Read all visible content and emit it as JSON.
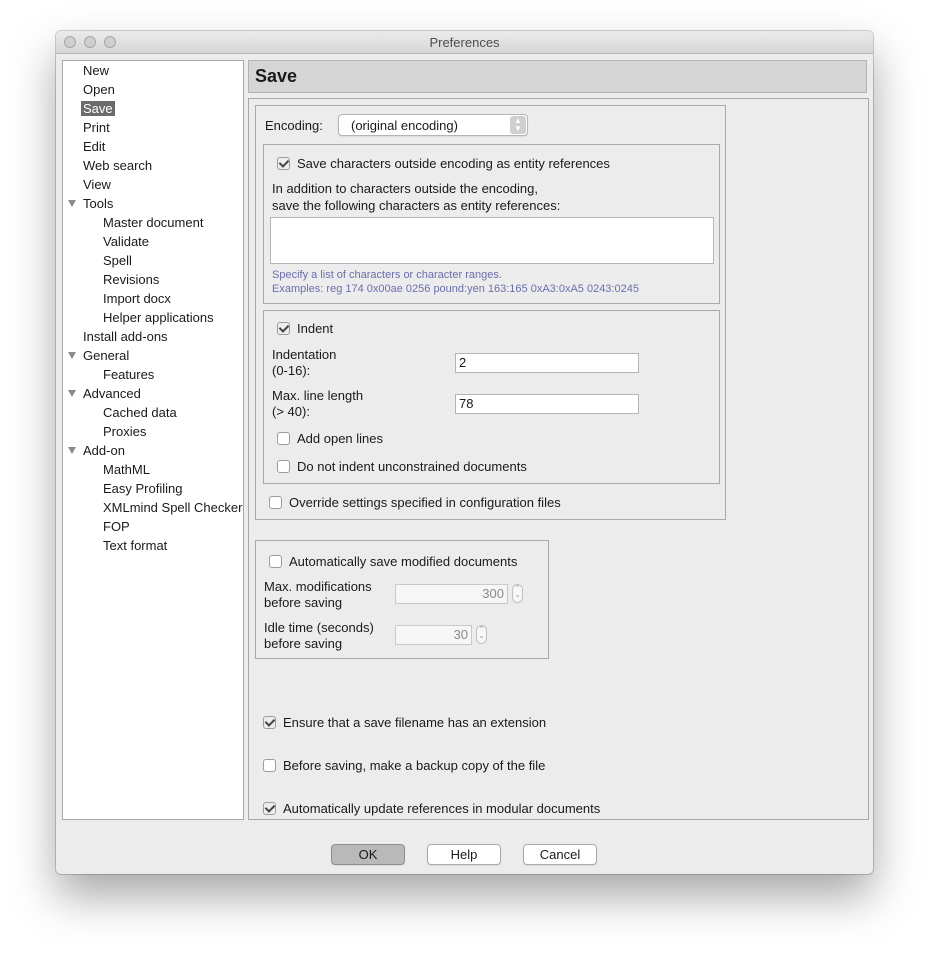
{
  "window": {
    "title": "Preferences"
  },
  "nav": {
    "items": [
      {
        "label": "New"
      },
      {
        "label": "Open"
      },
      {
        "label": "Save"
      },
      {
        "label": "Print"
      },
      {
        "label": "Edit"
      },
      {
        "label": "Web search"
      },
      {
        "label": "View"
      },
      {
        "label": "Tools"
      },
      {
        "label": "Master document"
      },
      {
        "label": "Validate"
      },
      {
        "label": "Spell"
      },
      {
        "label": "Revisions"
      },
      {
        "label": "Import docx"
      },
      {
        "label": "Helper applications"
      },
      {
        "label": "Install add-ons"
      },
      {
        "label": "General"
      },
      {
        "label": "Features"
      },
      {
        "label": "Advanced"
      },
      {
        "label": "Cached data"
      },
      {
        "label": "Proxies"
      },
      {
        "label": "Add-on"
      },
      {
        "label": "MathML"
      },
      {
        "label": "Easy Profiling"
      },
      {
        "label": "XMLmind Spell Checker"
      },
      {
        "label": "FOP"
      },
      {
        "label": "Text format"
      }
    ]
  },
  "page": {
    "title": "Save",
    "encoding": {
      "label": "Encoding:",
      "selected": "(original encoding)"
    },
    "entity": {
      "save_outside_label": "Save characters outside encoding as entity references",
      "save_outside_checked": true,
      "desc_line1": "In addition to characters outside the encoding,",
      "desc_line2": "save the following characters as entity references:",
      "chars_value": "",
      "hint_line1": "Specify a list of characters or character ranges.",
      "hint_line2": "Examples: reg 174 0x00ae 0256 pound:yen 163:165 0xA3:0xA5 0243:0245"
    },
    "indent": {
      "label": "Indent",
      "checked": true,
      "indentation_label1": "Indentation",
      "indentation_label2": "(0-16):",
      "indentation_value": "2",
      "max_line_label1": "Max. line length",
      "max_line_label2": "(> 40):",
      "max_line_value": "78",
      "open_lines_label": "Add open lines",
      "open_lines_checked": false,
      "unconstrained_label": "Do not indent unconstrained documents",
      "unconstrained_checked": false
    },
    "override": {
      "label": "Override settings specified in configuration files",
      "checked": false
    },
    "autosave": {
      "label": "Automatically save modified documents",
      "checked": false,
      "max_mod_label1": "Max. modifications",
      "max_mod_label2": "before saving",
      "max_mod_value": "300",
      "idle_label1": "Idle time (seconds)",
      "idle_label2": "before saving",
      "idle_value": "30"
    },
    "extension": {
      "label": "Ensure that a save filename has an extension",
      "checked": true
    },
    "backup": {
      "label": "Before saving, make a backup copy of the file",
      "checked": false
    },
    "modular": {
      "label": "Automatically update references in modular documents",
      "checked": true
    }
  },
  "buttons": {
    "ok": "OK",
    "help": "Help",
    "cancel": "Cancel"
  }
}
